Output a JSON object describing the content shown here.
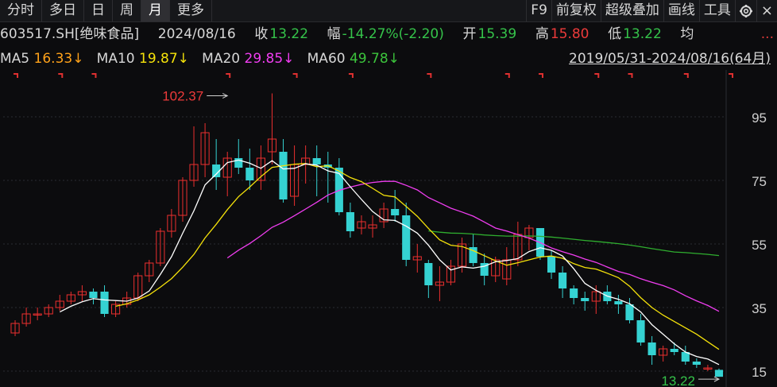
{
  "toolbar": {
    "left": [
      "分时",
      "多日",
      "日",
      "周",
      "月",
      "更多"
    ],
    "active": "月",
    "right": [
      "F9",
      "前复权",
      "超级叠加",
      "画线",
      "工具"
    ],
    "close_label": "×"
  },
  "info": {
    "code": "603517.SH[绝味食品]",
    "date": "2024/08/16",
    "close_label": "收",
    "close": "13.22",
    "change_label": "幅",
    "change": "-14.27%(-2.20)",
    "open_label": "开",
    "open": "15.39",
    "high_label": "高",
    "high": "15.80",
    "low_label": "低",
    "low": "13.22",
    "avg_label": "均",
    "more": "..."
  },
  "ma": {
    "ma5_label": "MA5",
    "ma5": "16.33↓",
    "ma10_label": "MA10",
    "ma10": "19.87↓",
    "ma20_label": "MA20",
    "ma20": "29.85↓",
    "ma60_label": "MA60",
    "ma60": "49.78↓",
    "range": "2019/05/31-2024/08/16(64月)"
  },
  "colors": {
    "up": "#ec2f2f",
    "down": "#35d2d2",
    "ma5": "#ffffff",
    "ma10": "#f5e20a",
    "ma20": "#f03df0",
    "ma60": "#2fae2f",
    "bg": "#0c0c0e",
    "grid": "#2a2c33"
  },
  "chart_data": {
    "type": "candlestick",
    "period": "monthly",
    "y_ticks": [
      95,
      75,
      55,
      35,
      15
    ],
    "ylim": [
      12,
      107
    ],
    "annotations": [
      {
        "label": "102.37",
        "value": 102.37,
        "index": 19,
        "kind": "high"
      },
      {
        "label": "13.22",
        "value": 13.22,
        "index": 63,
        "kind": "low"
      }
    ],
    "ohlc": [
      [
        27,
        31,
        26,
        30
      ],
      [
        30,
        35,
        29,
        33
      ],
      [
        33,
        35,
        31,
        33
      ],
      [
        33,
        36,
        32,
        35
      ],
      [
        35,
        39,
        34,
        37
      ],
      [
        37,
        40,
        36,
        39
      ],
      [
        39,
        42,
        37,
        40
      ],
      [
        40,
        41,
        36,
        38
      ],
      [
        40,
        42,
        32,
        33
      ],
      [
        33,
        37,
        32,
        36
      ],
      [
        36,
        40,
        35,
        38
      ],
      [
        38,
        46,
        37,
        45
      ],
      [
        45,
        50,
        43,
        49
      ],
      [
        49,
        60,
        48,
        59
      ],
      [
        59,
        66,
        57,
        64
      ],
      [
        64,
        76,
        62,
        75
      ],
      [
        75,
        92,
        73,
        80
      ],
      [
        80,
        93,
        76,
        90
      ],
      [
        80,
        88,
        72,
        76
      ],
      [
        76,
        84,
        70,
        82
      ],
      [
        82,
        88,
        77,
        79
      ],
      [
        79,
        85,
        72,
        75
      ],
      [
        75,
        86,
        72,
        82
      ],
      [
        84,
        102.37,
        80,
        88
      ],
      [
        84,
        88,
        68,
        69
      ],
      [
        70,
        86,
        67,
        80
      ],
      [
        80,
        86,
        74,
        82
      ],
      [
        82,
        86,
        70,
        80
      ],
      [
        80,
        84,
        68,
        79
      ],
      [
        79,
        82,
        64,
        65
      ],
      [
        65,
        68,
        57,
        59
      ],
      [
        60,
        64,
        58,
        62
      ],
      [
        60,
        64,
        57,
        61
      ],
      [
        62,
        68,
        60,
        66
      ],
      [
        66,
        72,
        62,
        64
      ],
      [
        64,
        68,
        48,
        50
      ],
      [
        50,
        55,
        46,
        51
      ],
      [
        49,
        50,
        38,
        42
      ],
      [
        42,
        48,
        37,
        43
      ],
      [
        43,
        50,
        42,
        48
      ],
      [
        48,
        57,
        46,
        55
      ],
      [
        54,
        58,
        48,
        49
      ],
      [
        49,
        52,
        42,
        45
      ],
      [
        45,
        51,
        43,
        50
      ],
      [
        44,
        54,
        42,
        50
      ],
      [
        50,
        62,
        48,
        58
      ],
      [
        57,
        61,
        53,
        60
      ],
      [
        60,
        58,
        50,
        51
      ],
      [
        51,
        53,
        44,
        46
      ],
      [
        46,
        48,
        38,
        41
      ],
      [
        41,
        42,
        36,
        38
      ],
      [
        38,
        40,
        34,
        37
      ],
      [
        37,
        42,
        33,
        40
      ],
      [
        40,
        42,
        36,
        37
      ],
      [
        37,
        39,
        33,
        36
      ],
      [
        36,
        38,
        30,
        31
      ],
      [
        31,
        33,
        23,
        24
      ],
      [
        24,
        26,
        17,
        20
      ],
      [
        20,
        23,
        18,
        22
      ],
      [
        22,
        24,
        20,
        21
      ],
      [
        21,
        23,
        17,
        18
      ],
      [
        18,
        19,
        16,
        17
      ],
      [
        16,
        17,
        15,
        16
      ],
      [
        15.39,
        15.8,
        13.22,
        13.22
      ]
    ],
    "ma5_last": 16.33,
    "ma10_last": 19.87,
    "ma20_last": 29.85,
    "ma60_last": 49.78
  }
}
